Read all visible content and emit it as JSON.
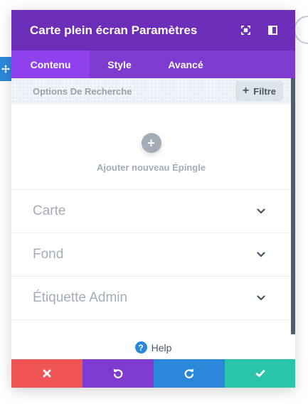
{
  "header": {
    "title": "Carte plein écran Paramètres",
    "color": "#6c2eb9"
  },
  "tabs": [
    {
      "label": "Contenu",
      "active": true
    },
    {
      "label": "Style",
      "active": false
    },
    {
      "label": "Avancé",
      "active": false
    }
  ],
  "search": {
    "label": "Options De Recherche",
    "filter_label": "Filtre"
  },
  "add_pin": {
    "label": "Ajouter nouveau Épingle"
  },
  "sections": [
    {
      "title": "Carte"
    },
    {
      "title": "Fond"
    },
    {
      "title": "Étiquette Admin"
    }
  ],
  "help": {
    "label": "Help",
    "icon_glyph": "?"
  },
  "footer_buttons": [
    {
      "name": "cancel",
      "icon": "close-icon",
      "color": "#ef5555"
    },
    {
      "name": "undo",
      "icon": "undo-icon",
      "color": "#7e3bd0"
    },
    {
      "name": "redo",
      "icon": "redo-icon",
      "color": "#2b87da"
    },
    {
      "name": "save",
      "icon": "check-icon",
      "color": "#29c4a9"
    }
  ]
}
